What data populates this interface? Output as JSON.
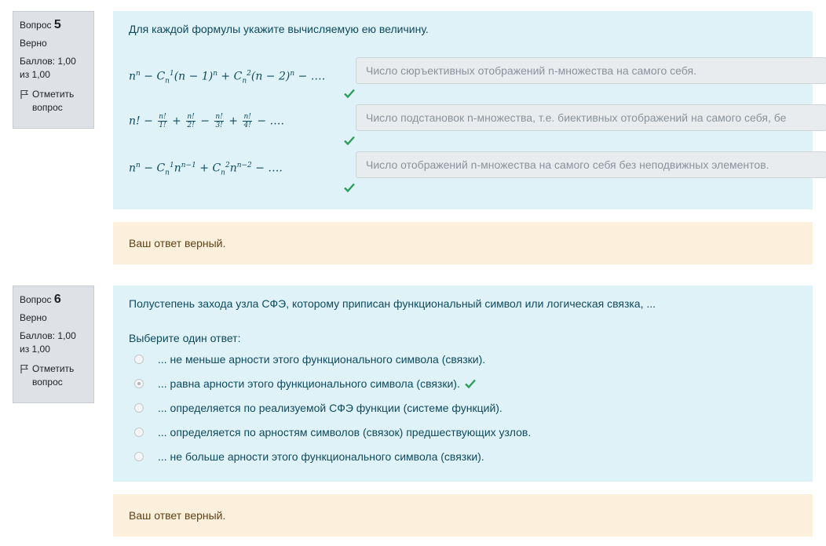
{
  "q5": {
    "label": "Вопрос",
    "number": "5",
    "status": "Верно",
    "score": "Баллов: 1,00 из 1,00",
    "flag_label": "Отметить вопрос",
    "question_text": "Для каждой формулы укажите вычисляемую ею величину.",
    "formulas": [
      "nⁿ − C¹ₙ(n − 1)ⁿ + C²ₙ(n − 2)ⁿ − ….",
      "n! − n!/1! + n!/2! − n!/3! + n!/4! − ….",
      "nⁿ − C¹ₙnⁿ⁻¹ + C²ₙnⁿ⁻² − …."
    ],
    "answers": [
      "Число сюръективных отображений n-множества на самого себя.",
      "Число подстановок n-множества, т.е. биективных отображений на самого себя, бе",
      "Число отображений n-множества на самого себя без неподвижных элементов."
    ],
    "feedback": "Ваш ответ верный."
  },
  "q6": {
    "label": "Вопрос",
    "number": "6",
    "status": "Верно",
    "score": "Баллов: 1,00 из 1,00",
    "flag_label": "Отметить вопрос",
    "question_text": "Полустепень захода узла СФЭ, которому приписан функциональный символ или логическая связка, ...",
    "prompt": "Выберите один ответ:",
    "options": [
      "... не меньше арности этого функционального символа (связки).",
      "... равна арности этого функционального символа (связки).",
      "... определяется по реализуемой СФЭ функции (системе функций).",
      "... определяется по арностям символов (связок) предшествующих узлов.",
      "... не больше арности этого функционального символа (связки)."
    ],
    "selected_index": 1,
    "feedback": "Ваш ответ верный."
  },
  "colors": {
    "correct": "#2f9e5a",
    "content_bg": "#dff2f8",
    "feedback_bg": "#fcefdc"
  }
}
